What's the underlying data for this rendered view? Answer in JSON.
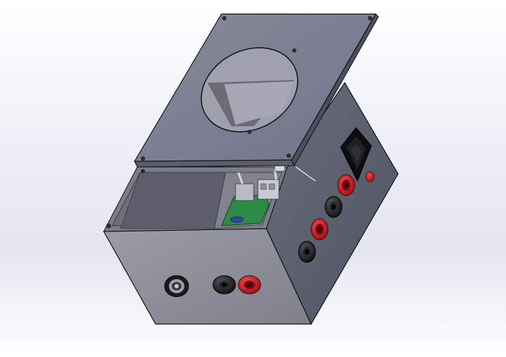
{
  "scene": {
    "colors": {
      "background_top": "#ffffff",
      "background_mid": "#e3e6f1",
      "lid_top": "#7c7f8f",
      "lid_edge": "#5f6270",
      "box_front": "#8a8c98",
      "box_side": "#5d6070",
      "box_inner": "#6f717d",
      "pcb": "#2f8a45",
      "jack_red": "#c8121c",
      "jack_black": "#1c1c1e",
      "switch": "#0d0d10",
      "led_red": "#d81b25",
      "outline": "#111111"
    },
    "parts": {
      "lid": {
        "mounting_holes": 4,
        "window": "circular-cutout"
      },
      "front_panel": {
        "jacks": [
          "bnc-connector",
          "black-binding-post",
          "red-binding-post"
        ]
      },
      "side_panel": {
        "controls": [
          "rocker-switch",
          "red-led",
          "red-binding-post",
          "black-binding-post",
          "red-binding-post",
          "black-binding-post"
        ]
      },
      "interior": {
        "components": [
          "circuit-board",
          "relay",
          "terminal-block",
          "screw-posts"
        ]
      }
    }
  }
}
